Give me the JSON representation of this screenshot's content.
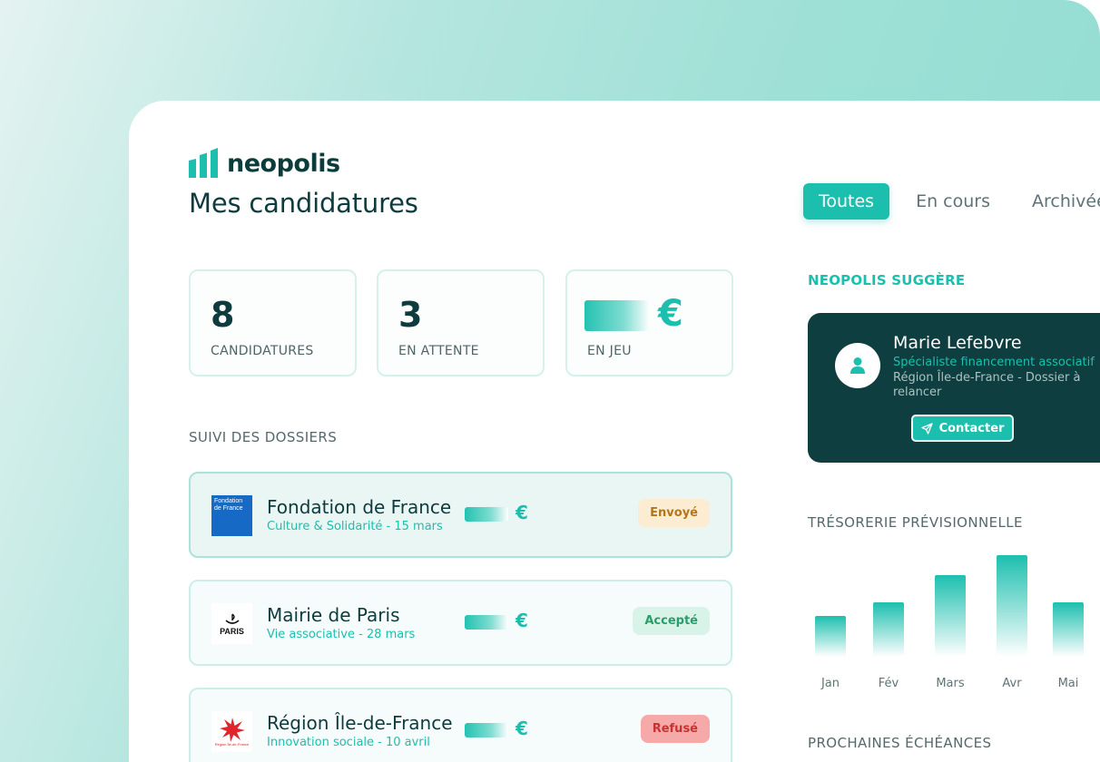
{
  "brand": {
    "name": "neopolis"
  },
  "page": {
    "title": "Mes candidatures"
  },
  "tabs": [
    {
      "label": "Toutes",
      "active": true
    },
    {
      "label": "En cours",
      "active": false
    },
    {
      "label": "Archivées",
      "active": false
    }
  ],
  "stats": [
    {
      "value": "8",
      "label": "CANDIDATURES"
    },
    {
      "value": "3",
      "label": "EN ATTENTE"
    },
    {
      "value": "€",
      "label": "EN JEU"
    }
  ],
  "dossiers": {
    "section_title": "SUIVI DES DOSSIERS",
    "items": [
      {
        "org": "Fondation de France",
        "detail": "Culture & Solidarité - 15 mars",
        "amount_symbol": "€",
        "status": "Envoyé",
        "logo_text": "Fondation de France"
      },
      {
        "org": "Mairie de Paris",
        "detail": "Vie associative - 28 mars",
        "amount_symbol": "€",
        "status": "Accepté",
        "logo_text": "PARIS"
      },
      {
        "org": "Région Île-de-France",
        "detail": "Innovation sociale - 10 avril",
        "amount_symbol": "€",
        "status": "Refusé",
        "logo_text": "Région Île-de-France"
      }
    ]
  },
  "suggestion": {
    "section_title": "NEOPOLIS SUGGÈRE",
    "name": "Marie Lefebvre",
    "role": "Spécialiste financement associatif",
    "description": "Région Île-de-France - Dossier à relancer",
    "button_label": "Contacter"
  },
  "treasury": {
    "section_title": "TRÉSORERIE PRÉVISIONNELLE"
  },
  "chart_data": {
    "type": "bar",
    "categories": [
      "Jan",
      "Fév",
      "Mars",
      "Avr",
      "Mai"
    ],
    "values": [
      3,
      4,
      6,
      7.5,
      4
    ],
    "ylim": [
      0,
      8
    ],
    "grid": false
  },
  "upcoming": {
    "section_title": "PROCHAINES ÉCHÉANCES"
  }
}
